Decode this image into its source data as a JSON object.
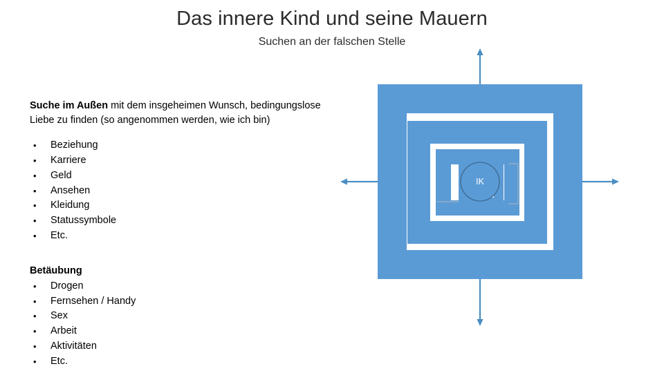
{
  "slide": {
    "title": "Das innere Kind und seine Mauern",
    "subtitle": "Suchen an der falschen Stelle"
  },
  "left_content": {
    "paragraph": {
      "lead": "Suche im Außen",
      "rest": " mit dem insgeheimen Wunsch, bedingungslose Liebe zu finden (so angenommen werden, wie ich bin)"
    },
    "search_bullets": [
      "Beziehung",
      "Karriere",
      "Geld",
      "Ansehen",
      "Kleidung",
      "Statussymbole",
      "Etc."
    ],
    "numbing_heading": "Betäubung",
    "numbing_bullets": [
      "Drogen",
      "Fernsehen / Handy",
      "Sex",
      "Arbeit",
      "Aktivitäten",
      "Etc."
    ],
    "bullet_glyph": "•"
  },
  "diagram": {
    "center_label": "IK",
    "colors": {
      "wall": "#5b9bd5",
      "circle_fill": "#5b9bd5",
      "circle_stroke": "#41719c",
      "arrow": "#4a8ec2",
      "gap": "#ffffff",
      "label": "#ffffff"
    },
    "arrows": [
      {
        "name": "arrow-up",
        "direction": "up"
      },
      {
        "name": "arrow-right",
        "direction": "right"
      },
      {
        "name": "arrow-down",
        "direction": "down"
      },
      {
        "name": "arrow-left",
        "direction": "left"
      }
    ],
    "wall_count": 4
  }
}
